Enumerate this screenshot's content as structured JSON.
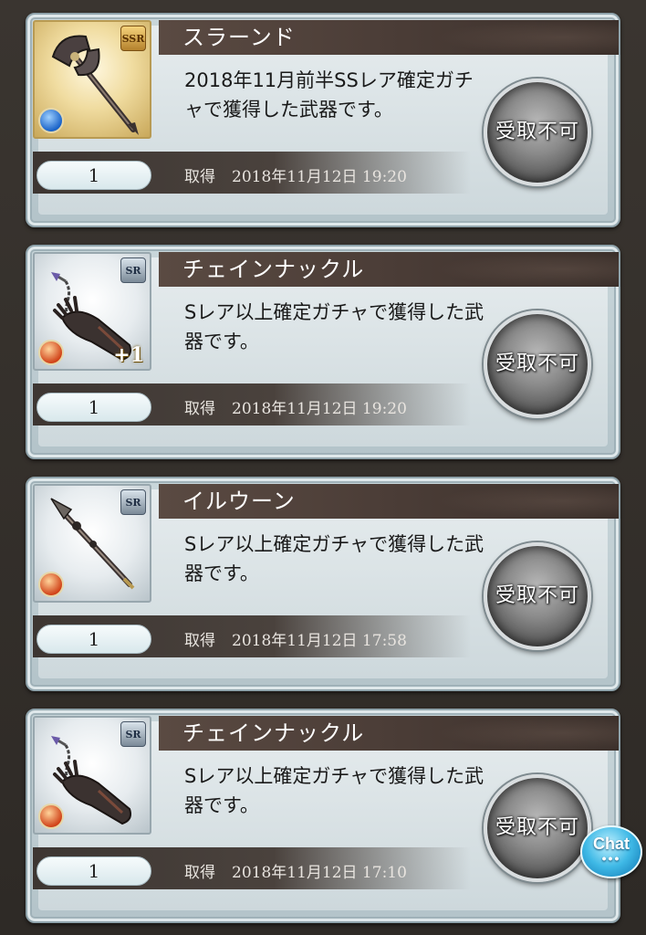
{
  "button_label": "受取不可",
  "acquired_label": "取得",
  "chat_label": "Chat",
  "chat_dots": "•••",
  "items": [
    {
      "name": "スラーンド",
      "description": "2018年11月前半SSレア確定ガチャで獲得した武器です。",
      "rarity": "SSR",
      "element": "water",
      "plus": "",
      "count": "1",
      "date": "2018年11月12日 19:20",
      "weapon_icon": "axe-icon"
    },
    {
      "name": "チェインナックル",
      "description": "Sレア以上確定ガチャで獲得した武器です。",
      "rarity": "SR",
      "element": "fire",
      "plus": "+1",
      "count": "1",
      "date": "2018年11月12日 19:20",
      "weapon_icon": "gauntlet-icon"
    },
    {
      "name": "イルウーン",
      "description": "Sレア以上確定ガチャで獲得した武器です。",
      "rarity": "SR",
      "element": "fire",
      "plus": "",
      "count": "1",
      "date": "2018年11月12日 17:58",
      "weapon_icon": "spear-icon"
    },
    {
      "name": "チェインナックル",
      "description": "Sレア以上確定ガチャで獲得した武器です。",
      "rarity": "SR",
      "element": "fire",
      "plus": "",
      "count": "1",
      "date": "2018年11月12日 17:10",
      "weapon_icon": "gauntlet-icon"
    }
  ]
}
